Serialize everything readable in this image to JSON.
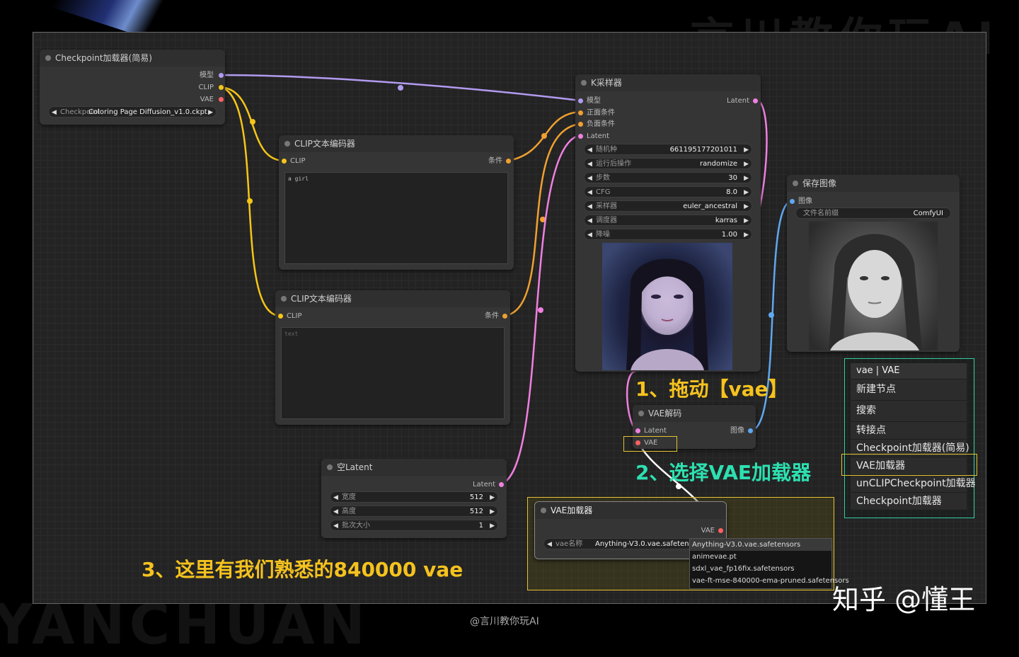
{
  "watermark": {
    "top_right": "言川教你玩AI",
    "bottom_left": "YANCHUAN",
    "bottom_center": "@言川教你玩AI",
    "zhihu": "知乎 @懂王"
  },
  "nodes": {
    "checkpoint": {
      "title": "Checkpoint加载器(简易)",
      "out_model": "模型",
      "out_clip": "CLIP",
      "out_vae": "VAE",
      "ckpt_label": "Checkpoint",
      "ckpt_value": "Coloring Page Diffusion_v1.0.ckpt"
    },
    "clip_pos": {
      "title": "CLIP文本编码器",
      "in_clip": "CLIP",
      "out_cond": "条件",
      "text": "a girl"
    },
    "clip_neg": {
      "title": "CLIP文本编码器",
      "in_clip": "CLIP",
      "out_cond": "条件",
      "placeholder": "text"
    },
    "ksampler": {
      "title": "K采样器",
      "in_model": "模型",
      "in_pos": "正面条件",
      "in_neg": "负面条件",
      "in_latent": "Latent",
      "out_latent": "Latent",
      "widgets": [
        {
          "label": "随机种",
          "value": "661195177201011"
        },
        {
          "label": "运行后操作",
          "value": "randomize"
        },
        {
          "label": "步数",
          "value": "30"
        },
        {
          "label": "CFG",
          "value": "8.0"
        },
        {
          "label": "采样器",
          "value": "euler_ancestral"
        },
        {
          "label": "调度器",
          "value": "karras"
        },
        {
          "label": "降噪",
          "value": "1.00"
        }
      ]
    },
    "save": {
      "title": "保存图像",
      "in_image": "图像",
      "prefix_label": "文件名前缀",
      "prefix_value": "ComfyUI"
    },
    "vae_decode": {
      "title": "VAE解码",
      "in_latent": "Latent",
      "in_vae": "VAE",
      "out_image": "图像"
    },
    "empty_latent": {
      "title": "空Latent",
      "out_latent": "Latent",
      "widgets": [
        {
          "label": "宽度",
          "value": "512"
        },
        {
          "label": "高度",
          "value": "512"
        },
        {
          "label": "批次大小",
          "value": "1"
        }
      ]
    },
    "vae_loader": {
      "title": "VAE加载器",
      "out_vae": "VAE",
      "vae_label": "vae名称",
      "vae_value": "Anything-V3.0.vae.safetensors"
    }
  },
  "vae_dropdown": [
    "Anything-V3.0.vae.safetensors",
    "animevae.pt",
    "sdxl_vae_fp16fix.safetensors",
    "vae-ft-mse-840000-ema-pruned.safetensors"
  ],
  "context_menu": {
    "search_value": "vae | VAE",
    "items": [
      "新建节点",
      "搜索",
      "转接点",
      "Checkpoint加载器(简易)",
      "VAE加载器",
      "unCLIPCheckpoint加载器",
      "Checkpoint加载器"
    ]
  },
  "annotations": {
    "step1": "1、拖动【vae】",
    "step2": "2、选择VAE加载器",
    "step3": "3、这里有我们熟悉的840000 vae"
  },
  "colors": {
    "model_wire": "#b29bf0",
    "clip_wire": "#f5c518",
    "cond_wire": "#f0a030",
    "latent_wire": "#f080e0",
    "vae_wire": "#ff6060",
    "image_wire": "#60a8f0",
    "annot_yellow": "#f5c21e",
    "annot_green": "#2de0b0",
    "menu_border": "#2fd0a0"
  }
}
